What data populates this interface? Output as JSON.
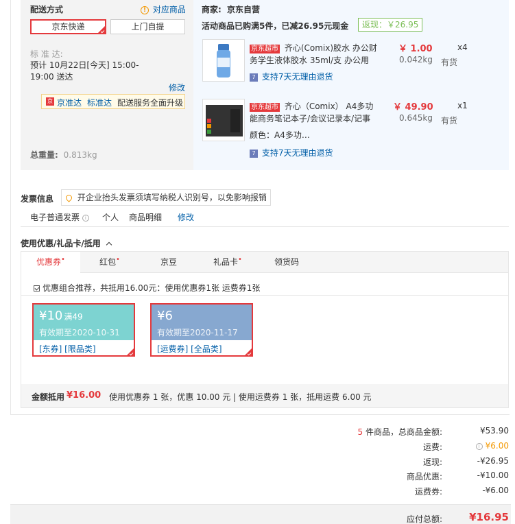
{
  "delivery": {
    "title": "配送方式",
    "matched_goods_link": "对应商品",
    "options": [
      "京东快递",
      "上门自提"
    ],
    "eta_label": "标 准 达:",
    "eta_line1": "预计 10月22日[今天] 15:00-",
    "eta_line2": "19:00 送达",
    "modify": "修改",
    "jzd_badge": "京准达",
    "jzd_standard": "标准达",
    "jzd_text": "配送服务全面升级",
    "weight_label": "总重量:",
    "weight_value": "0.813kg"
  },
  "seller": {
    "label": "商家:",
    "name": "京东自营",
    "promo": "活动商品已购满5件，已减26.95元现金",
    "rebate": "返现：￥26.95"
  },
  "items": [
    {
      "badge": "京东超市",
      "title_line1": "齐心(Comix)胶水 办公财",
      "title_line2": "务学生液体胶水 35ml/支 办公用",
      "price": "￥ 1.00",
      "qty": "x4",
      "weight": "0.042kg",
      "stock": "有货",
      "color": "",
      "return": "支持7天无理由退货"
    },
    {
      "badge": "京东超市",
      "title_line1": "齐心（Comix） A4多功",
      "title_line2": "能商务笔记本子/会议记录本/记事",
      "price": "￥ 49.90",
      "qty": "x1",
      "weight": "0.645kg",
      "stock": "有货",
      "color": "颜色：A4多功…",
      "return": "支持7天无理由退货"
    }
  ],
  "invoice": {
    "title": "发票信息",
    "tip": "开企业抬头发票须填写纳税人识别号，以免影响报销",
    "type": "电子普通发票",
    "holder": "个人",
    "content": "商品明细",
    "modify": "修改"
  },
  "discount": {
    "title": "使用优惠/礼品卡/抵用",
    "tabs": [
      "优惠券",
      "红包",
      "京豆",
      "礼品卡",
      "领货码"
    ],
    "tab_marks": [
      "•",
      "•",
      "",
      "•",
      ""
    ],
    "recommend": "优惠组合推荐，共抵用16.00元：使用优惠券1张 运费券1张",
    "coupons": [
      {
        "amount": "¥10",
        "condition": "满49",
        "valid": "有效期至2020-10-31",
        "tags": "[东券]  [限品类]",
        "color": "#7dd3d1"
      },
      {
        "amount": "¥6",
        "condition": "",
        "valid": "有效期至2020-11-17",
        "tags": "[运费券]  [全品类]",
        "color": "#87a8d0"
      }
    ],
    "summary_label": "金额抵用",
    "summary_amount": "¥16.00",
    "summary_detail": "使用优惠券 1 张，优惠 10.00 元  | 使用运费券 1 张，抵用运费 6.00 元"
  },
  "totals": {
    "count": "5",
    "count_suffix": " 件商品，总商品金额:",
    "goods_total": "¥53.90",
    "freight_label": "运费:",
    "freight_value": "¥6.00",
    "rebate_label": "返现:",
    "rebate_value": "-¥26.95",
    "coupon_label": "商品优惠:",
    "coupon_value": "-¥10.00",
    "freight_coupon_label": "运费券:",
    "freight_coupon_value": "-¥6.00",
    "payable_label": "应付总额:",
    "payable_value": "¥16.95"
  },
  "colors": {
    "accent_red": "#e4393c",
    "link_blue": "#005ea7",
    "rebate_green": "#7abd54"
  }
}
